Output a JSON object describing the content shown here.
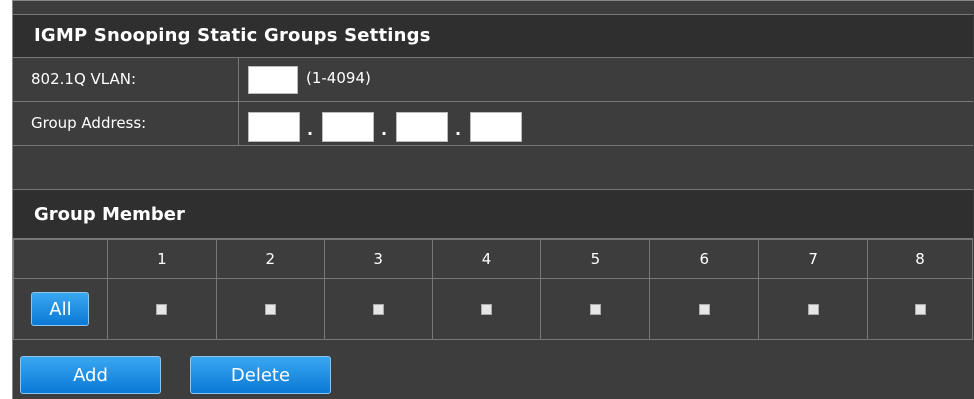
{
  "static_groups": {
    "title": "IGMP Snooping Static Groups Settings",
    "vlan": {
      "label": "802.1Q VLAN:",
      "value": "",
      "hint": "(1-4094)"
    },
    "group_address": {
      "label": "Group Address:",
      "octets": [
        "",
        "",
        "",
        ""
      ],
      "separator": "."
    }
  },
  "group_member": {
    "title": "Group Member",
    "ports": [
      "1",
      "2",
      "3",
      "4",
      "5",
      "6",
      "7",
      "8"
    ],
    "all_button": "All"
  },
  "actions": {
    "add_label": "Add",
    "delete_label": "Delete"
  },
  "colors": {
    "panel_bg": "#3d3d3d",
    "button_blue": "#1a8ae6",
    "text": "#ffffff"
  }
}
